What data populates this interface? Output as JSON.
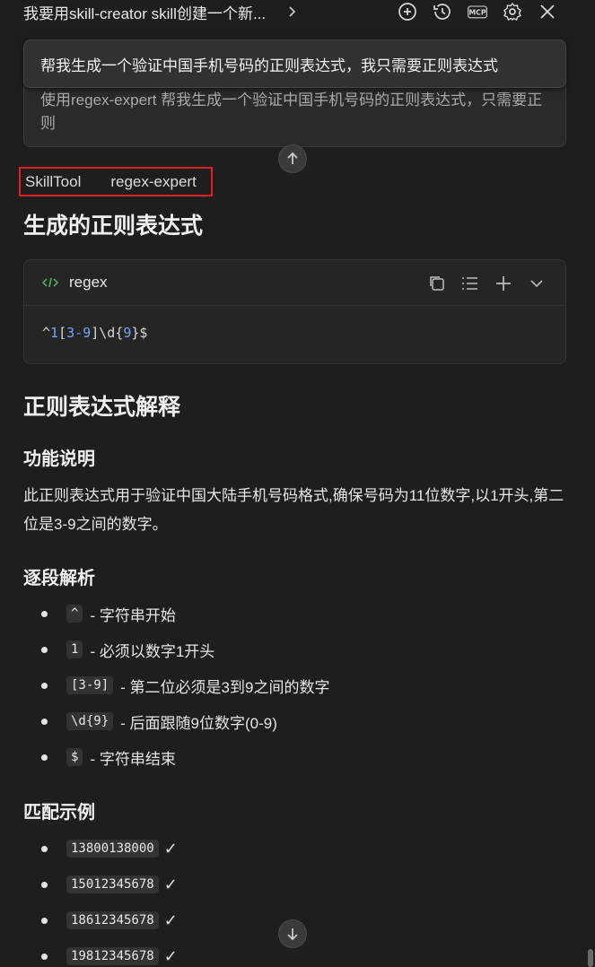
{
  "header": {
    "title": "我要用skill-creator skill创建一个新...",
    "icons": [
      "new-chat-icon",
      "history-icon",
      "mcp-icon",
      "settings-icon",
      "close-icon"
    ],
    "mcp_label": "MCP"
  },
  "user_message": {
    "main": "帮我生成一个验证中国手机号码的正则表达式，我只需要正则表达式",
    "detail": "使用regex-expert 帮我生成一个验证中国手机号码的正则表达式，只需要正则"
  },
  "skill_call": {
    "tool": "SkillTool",
    "name": "regex-expert"
  },
  "response": {
    "title": "生成的正则表达式",
    "code_block": {
      "language": "regex",
      "code_parts": [
        {
          "text": "^",
          "highlight": false
        },
        {
          "text": "1",
          "highlight": true
        },
        {
          "text": "[",
          "highlight": false
        },
        {
          "text": "3-9",
          "highlight": true
        },
        {
          "text": "]\\d{",
          "highlight": false
        },
        {
          "text": "9",
          "highlight": true
        },
        {
          "text": "}$",
          "highlight": false
        }
      ]
    },
    "explain_title": "正则表达式解释",
    "function_title": "功能说明",
    "function_text": "此正则表达式用于验证中国大陆手机号码格式,确保号码为11位数字,以1开头,第二位是3-9之间的数字。",
    "segments_title": "逐段解析",
    "segments": [
      {
        "code": "^",
        "text": "- 字符串开始"
      },
      {
        "code": "1",
        "text": "- 必须以数字1开头"
      },
      {
        "code": "[3-9]",
        "text": "- 第二位必须是3到9之间的数字"
      },
      {
        "code": "\\d{9}",
        "text": "- 后面跟随9位数字(0-9)"
      },
      {
        "code": "$",
        "text": "- 字符串结束"
      }
    ],
    "examples_title": "匹配示例",
    "examples": [
      {
        "code": "13800138000",
        "mark": "✓"
      },
      {
        "code": "15012345678",
        "mark": "✓"
      },
      {
        "code": "18612345678",
        "mark": "✓"
      },
      {
        "code": "19812345678",
        "mark": "✓"
      }
    ]
  },
  "colors": {
    "background": "#1e1e1e",
    "highlight_box": "#e02020",
    "code_number": "#7aa2f7"
  }
}
